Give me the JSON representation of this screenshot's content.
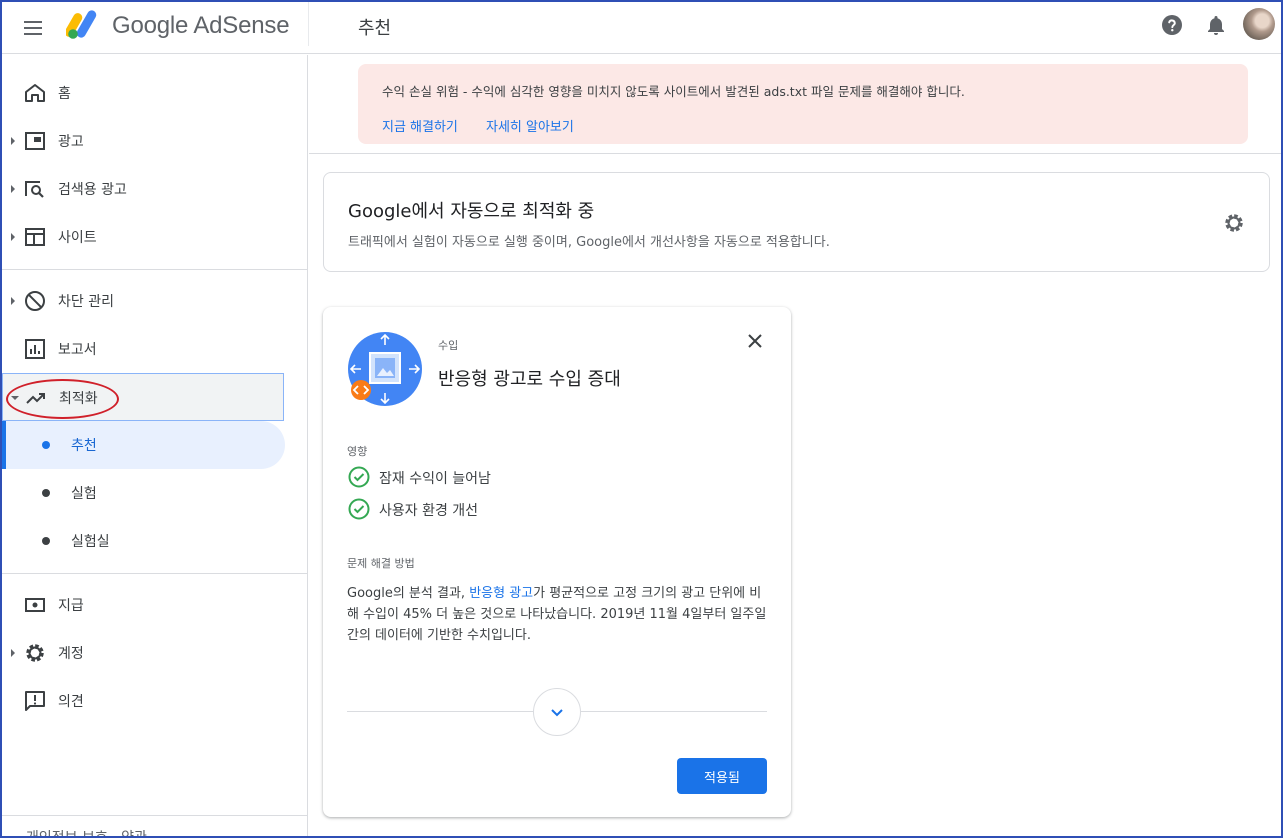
{
  "header": {
    "brand": "Google AdSense",
    "page_title": "추천"
  },
  "sidebar": {
    "items": [
      {
        "label": "홈",
        "icon": "home-icon"
      },
      {
        "label": "광고",
        "icon": "ads-icon"
      },
      {
        "label": "검색용 광고",
        "icon": "search-ads-icon"
      },
      {
        "label": "사이트",
        "icon": "sites-icon"
      },
      {
        "label": "차단 관리",
        "icon": "block-icon"
      },
      {
        "label": "보고서",
        "icon": "reports-icon"
      },
      {
        "label": "최적화",
        "icon": "trending-up-icon"
      },
      {
        "label": "지급",
        "icon": "payments-icon"
      },
      {
        "label": "계정",
        "icon": "gear-icon"
      },
      {
        "label": "의견",
        "icon": "feedback-icon"
      }
    ],
    "sub_items": [
      {
        "label": "추천",
        "active": true
      },
      {
        "label": "실험",
        "active": false
      },
      {
        "label": "실험실",
        "active": false
      }
    ],
    "footer": "개인정보 보호 · 약관"
  },
  "alert": {
    "message": "수익 손실 위험 - 수익에 심각한 영향을 미치지 않도록 사이트에서 발견된 ads.txt 파일 문제를 해결해야 합니다.",
    "fix_link": "지금 해결하기",
    "learn_link": "자세히 알아보기"
  },
  "auto_opt": {
    "title": "Google에서 자동으로 최적화 중",
    "description": "트래픽에서 실험이 자동으로 실행 중이며, Google에서 개선사항을 자동으로 적용합니다."
  },
  "recommendation": {
    "category": "수입",
    "title": "반응형 광고로 수입 증대",
    "impact_label": "영향",
    "impacts": [
      "잠재 수익이 늘어남",
      "사용자 환경 개선"
    ],
    "solution_label": "문제 해결 방법",
    "solution_prefix": "Google의 분석 결과, ",
    "solution_link": "반응형 광고",
    "solution_suffix": "가 평균적으로 고정 크기의 광고 단위에 비해 수입이 45% 더 높은 것으로 나타났습니다. 2019년 11월 4일부터 일주일간의 데이터에 기반한 수치입니다.",
    "apply_button": "적용됨"
  },
  "colors": {
    "accent": "#1a73e8",
    "alert_bg": "#fce8e6",
    "check_green": "#34a853",
    "annotation_red": "#d0202a"
  }
}
